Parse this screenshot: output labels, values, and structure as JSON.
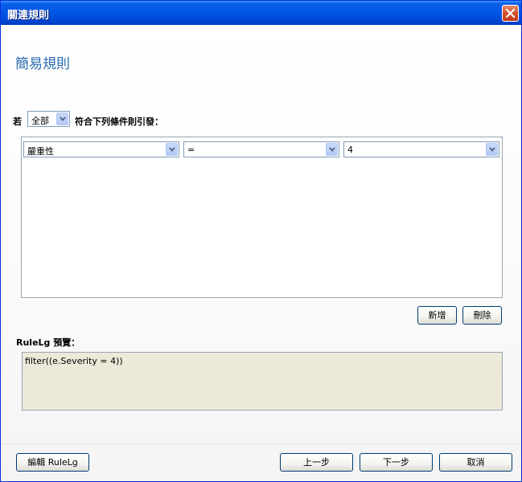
{
  "window": {
    "title": "關連規則"
  },
  "page": {
    "heading": "簡易規則"
  },
  "condition": {
    "prefix": "若",
    "match_select": "全部",
    "suffix": "符合下列條件則引發："
  },
  "rule_row": {
    "field": "嚴重性",
    "operator": "=",
    "value": "4"
  },
  "row_buttons": {
    "add": "新增",
    "delete": "刪除"
  },
  "preview": {
    "label": "RuleLg 預覽：",
    "text": "filter((e.Severity = 4))"
  },
  "footer": {
    "edit_rulelg": "編輯 RuleLg",
    "back": "上一步",
    "next": "下一步",
    "cancel": "取消"
  },
  "icons": {
    "close": "close-icon",
    "dropdown": "chevron-down-icon"
  },
  "colors": {
    "titlebar": "#0055e5",
    "heading": "#2a6cb0",
    "preview_bg": "#ece9d8"
  }
}
